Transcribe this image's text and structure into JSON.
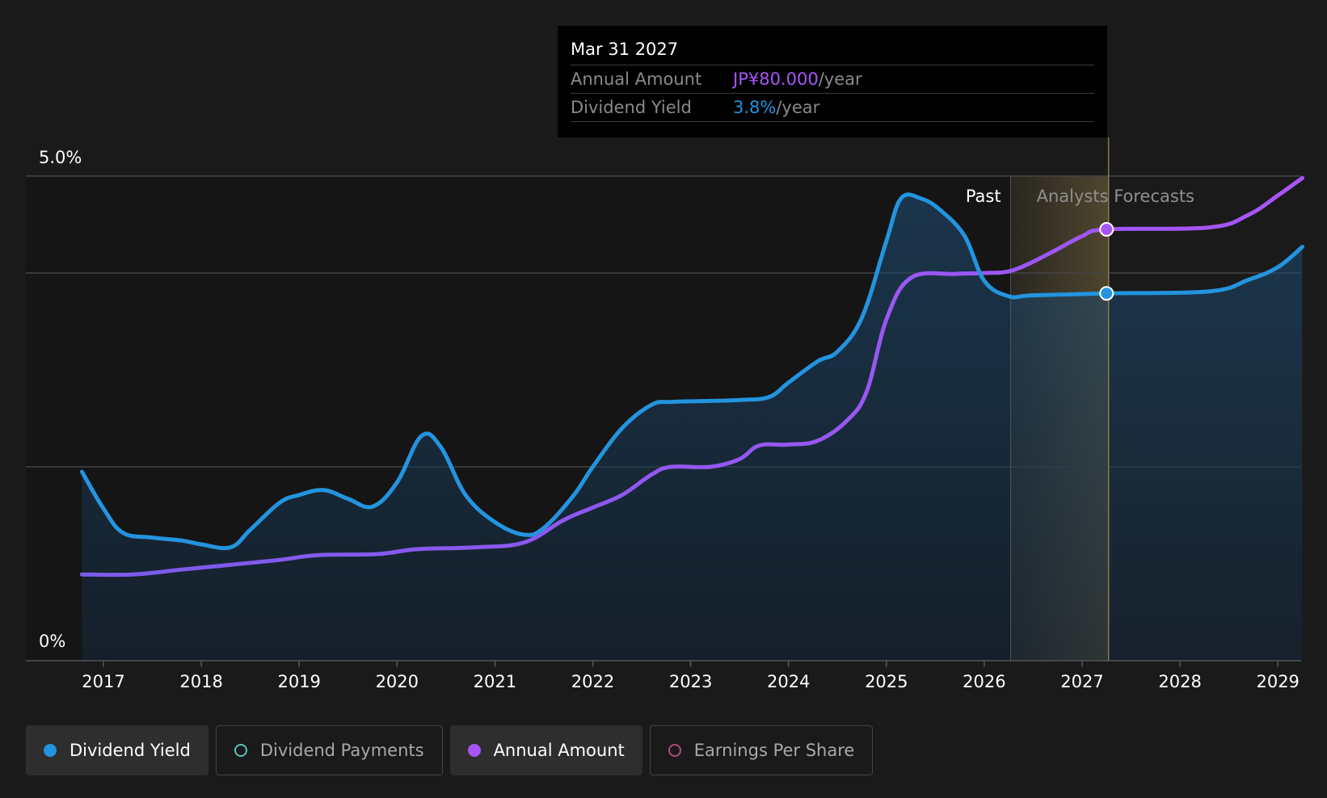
{
  "colors": {
    "dividend_yield": "#2394df",
    "annual_amount": "#a855f7",
    "dividend_payments": "#5ec4b6",
    "earnings_per_share": "#b24a7f",
    "background": "#1a1a1a",
    "forecast_band": "#7a6a40"
  },
  "tooltip": {
    "date": "Mar 31 2027",
    "rows": [
      {
        "label": "Annual Amount",
        "value": "JP¥80.000",
        "unit": "/year"
      },
      {
        "label": "Dividend Yield",
        "value": "3.8%",
        "unit": "/year"
      }
    ]
  },
  "legend": [
    {
      "label": "Dividend Yield",
      "icon": "filled-circle-icon",
      "active": true
    },
    {
      "label": "Dividend Payments",
      "icon": "hollow-circle-icon",
      "active": false
    },
    {
      "label": "Annual Amount",
      "icon": "filled-circle-icon",
      "active": true
    },
    {
      "label": "Earnings Per Share",
      "icon": "hollow-circle-icon",
      "active": false
    }
  ],
  "chart_data": {
    "type": "area",
    "x_tick_labels": [
      "2017",
      "2018",
      "2019",
      "2020",
      "2021",
      "2022",
      "2023",
      "2024",
      "2025",
      "2026",
      "2027",
      "2028",
      "2029"
    ],
    "y_tick_labels": [
      "5.0%",
      "0%"
    ],
    "ylim": [
      0,
      5.0
    ],
    "xlim": [
      2016.25,
      2029.25
    ],
    "grid_values": [
      5.0,
      4.0,
      2.0
    ],
    "past_label": "Past",
    "forecast_label": "Analysts Forecasts",
    "past_end": 2026.27,
    "forecast_end": 2027.27,
    "highlight_x": 2027.25,
    "legend_position": "bottom",
    "series": [
      {
        "name": "Dividend Yield",
        "points": [
          [
            2016.78,
            1.95
          ],
          [
            2017.0,
            1.57
          ],
          [
            2017.2,
            1.32
          ],
          [
            2017.5,
            1.27
          ],
          [
            2017.8,
            1.24
          ],
          [
            2018.0,
            1.2
          ],
          [
            2018.3,
            1.17
          ],
          [
            2018.5,
            1.35
          ],
          [
            2018.8,
            1.63
          ],
          [
            2019.0,
            1.71
          ],
          [
            2019.25,
            1.76
          ],
          [
            2019.5,
            1.67
          ],
          [
            2019.75,
            1.59
          ],
          [
            2020.0,
            1.84
          ],
          [
            2020.25,
            2.32
          ],
          [
            2020.45,
            2.2
          ],
          [
            2020.7,
            1.71
          ],
          [
            2021.0,
            1.43
          ],
          [
            2021.3,
            1.3
          ],
          [
            2021.5,
            1.37
          ],
          [
            2021.8,
            1.7
          ],
          [
            2022.0,
            2.0
          ],
          [
            2022.3,
            2.4
          ],
          [
            2022.6,
            2.64
          ],
          [
            2022.8,
            2.67
          ],
          [
            2023.2,
            2.68
          ],
          [
            2023.5,
            2.69
          ],
          [
            2023.8,
            2.72
          ],
          [
            2024.0,
            2.87
          ],
          [
            2024.3,
            3.09
          ],
          [
            2024.5,
            3.19
          ],
          [
            2024.75,
            3.54
          ],
          [
            2025.0,
            4.33
          ],
          [
            2025.15,
            4.77
          ],
          [
            2025.35,
            4.77
          ],
          [
            2025.55,
            4.65
          ],
          [
            2025.8,
            4.38
          ],
          [
            2026.0,
            3.92
          ],
          [
            2026.25,
            3.76
          ],
          [
            2026.5,
            3.77
          ],
          [
            2027.25,
            3.79
          ],
          [
            2028.3,
            3.81
          ],
          [
            2028.7,
            3.93
          ],
          [
            2029.0,
            4.06
          ],
          [
            2029.25,
            4.27
          ]
        ]
      },
      {
        "name": "Annual Amount",
        "points": [
          [
            2016.78,
            0.89
          ],
          [
            2017.3,
            0.89
          ],
          [
            2017.8,
            0.94
          ],
          [
            2018.3,
            0.99
          ],
          [
            2018.8,
            1.04
          ],
          [
            2019.2,
            1.09
          ],
          [
            2019.8,
            1.1
          ],
          [
            2020.2,
            1.15
          ],
          [
            2020.8,
            1.17
          ],
          [
            2021.3,
            1.22
          ],
          [
            2021.7,
            1.45
          ],
          [
            2022.0,
            1.58
          ],
          [
            2022.3,
            1.71
          ],
          [
            2022.6,
            1.92
          ],
          [
            2022.8,
            2.0
          ],
          [
            2023.2,
            2.0
          ],
          [
            2023.5,
            2.08
          ],
          [
            2023.7,
            2.22
          ],
          [
            2024.0,
            2.23
          ],
          [
            2024.3,
            2.27
          ],
          [
            2024.6,
            2.48
          ],
          [
            2024.8,
            2.78
          ],
          [
            2025.0,
            3.52
          ],
          [
            2025.25,
            3.95
          ],
          [
            2025.7,
            3.99
          ],
          [
            2026.0,
            4.0
          ],
          [
            2026.3,
            4.03
          ],
          [
            2026.7,
            4.22
          ],
          [
            2027.0,
            4.38
          ],
          [
            2027.25,
            4.45
          ],
          [
            2028.3,
            4.47
          ],
          [
            2028.7,
            4.6
          ],
          [
            2029.0,
            4.8
          ],
          [
            2029.25,
            4.98
          ]
        ]
      }
    ],
    "highlight_values": {
      "Dividend Yield": 3.79,
      "Annual Amount": 4.45
    }
  }
}
